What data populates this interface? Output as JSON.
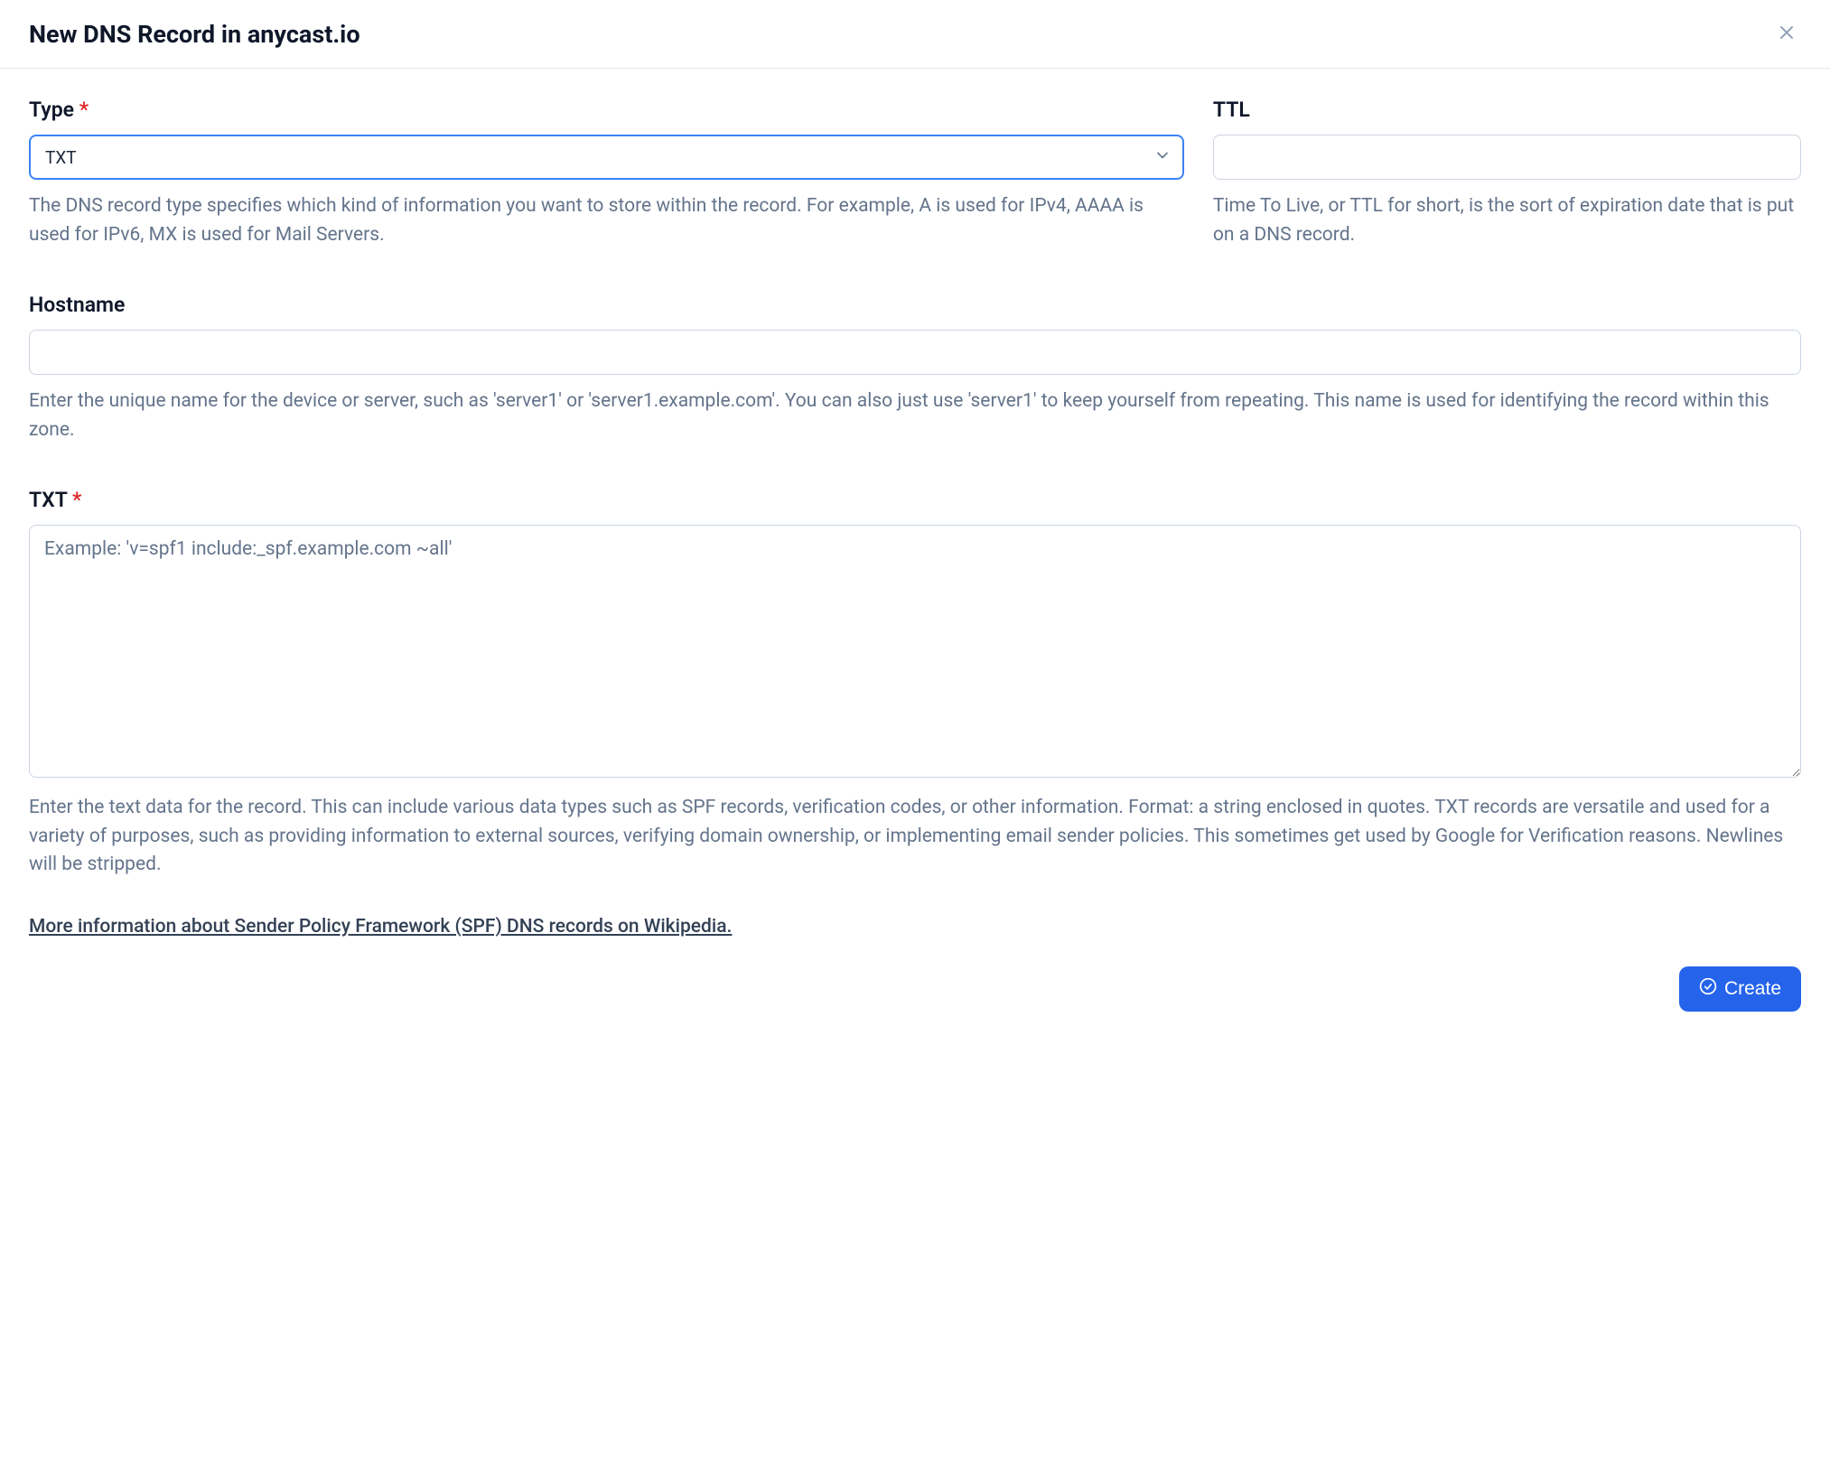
{
  "header": {
    "title": "New DNS Record in anycast.io"
  },
  "type": {
    "label": "Type",
    "value": "TXT",
    "help": "The DNS record type specifies which kind of information you want to store within the record. For example, A is used for IPv4, AAAA is used for IPv6, MX is used for Mail Servers."
  },
  "ttl": {
    "label": "TTL",
    "value": "",
    "help": "Time To Live, or TTL for short, is the sort of expiration date that is put on a DNS record."
  },
  "hostname": {
    "label": "Hostname",
    "value": "",
    "help": "Enter the unique name for the device or server, such as 'server1' or 'server1.example.com'. You can also just use 'server1' to keep yourself from repeating. This name is used for identifying the record within this zone."
  },
  "txt": {
    "label": "TXT",
    "value": "",
    "placeholder": "Example: 'v=spf1 include:_spf.example.com ~all'",
    "help": "Enter the text data for the record. This can include various data types such as SPF records, verification codes, or other information. Format: a string enclosed in quotes. TXT records are versatile and used for a variety of purposes, such as providing information to external sources, verifying domain ownership, or implementing email sender policies. This sometimes get used by Google for Verification reasons. Newlines will be stripped."
  },
  "link": {
    "text": "More information about Sender Policy Framework (SPF) DNS records on Wikipedia."
  },
  "footer": {
    "create_label": "Create"
  }
}
